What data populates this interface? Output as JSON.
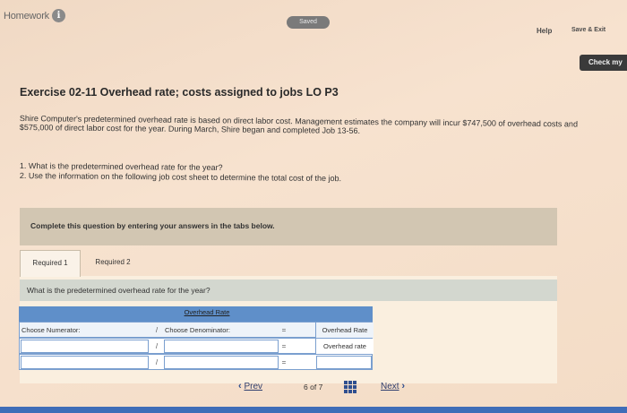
{
  "header": {
    "app_title": "Homework",
    "info_icon": "i",
    "status": "Saved",
    "help": "Help",
    "save_exit": "Save & Exit",
    "check_my": "Check my"
  },
  "exercise": {
    "title": "Exercise 02-11 Overhead rate; costs assigned to jobs LO P3",
    "body": "Shire Computer's predetermined overhead rate is based on direct labor cost. Management estimates the company will incur $747,500 of overhead costs and $575,000 of direct labor cost for the year. During March, Shire began and completed Job 13-56.",
    "q1": "1. What is the predetermined overhead rate for the year?",
    "q2": "2. Use the information on the following job cost sheet to determine the total cost of the job."
  },
  "instructions": "Complete this question by entering your answers in the tabs below.",
  "tabs": [
    {
      "label": "Required 1",
      "active": true
    },
    {
      "label": "Required 2",
      "active": false
    }
  ],
  "question": "What is the predetermined overhead rate for the year?",
  "table": {
    "top_header": "Overhead Rate",
    "numerator_header": "Choose Numerator:",
    "divide_symbol": "/",
    "denominator_header": "Choose Denominator:",
    "equals_symbol": "=",
    "result_header": "Overhead Rate",
    "rows": [
      {
        "numerator": "",
        "denominator": "",
        "result": "Overhead rate"
      },
      {
        "numerator": "",
        "denominator": "",
        "result": ""
      }
    ]
  },
  "pagination": {
    "prev": "Prev",
    "current": "6",
    "of_label": "of",
    "total": "7",
    "next": "Next"
  },
  "colors": {
    "table_header": "#5f8fc9",
    "bottom_bar": "#3f6db8",
    "question_bar": "#d3d7cf"
  }
}
